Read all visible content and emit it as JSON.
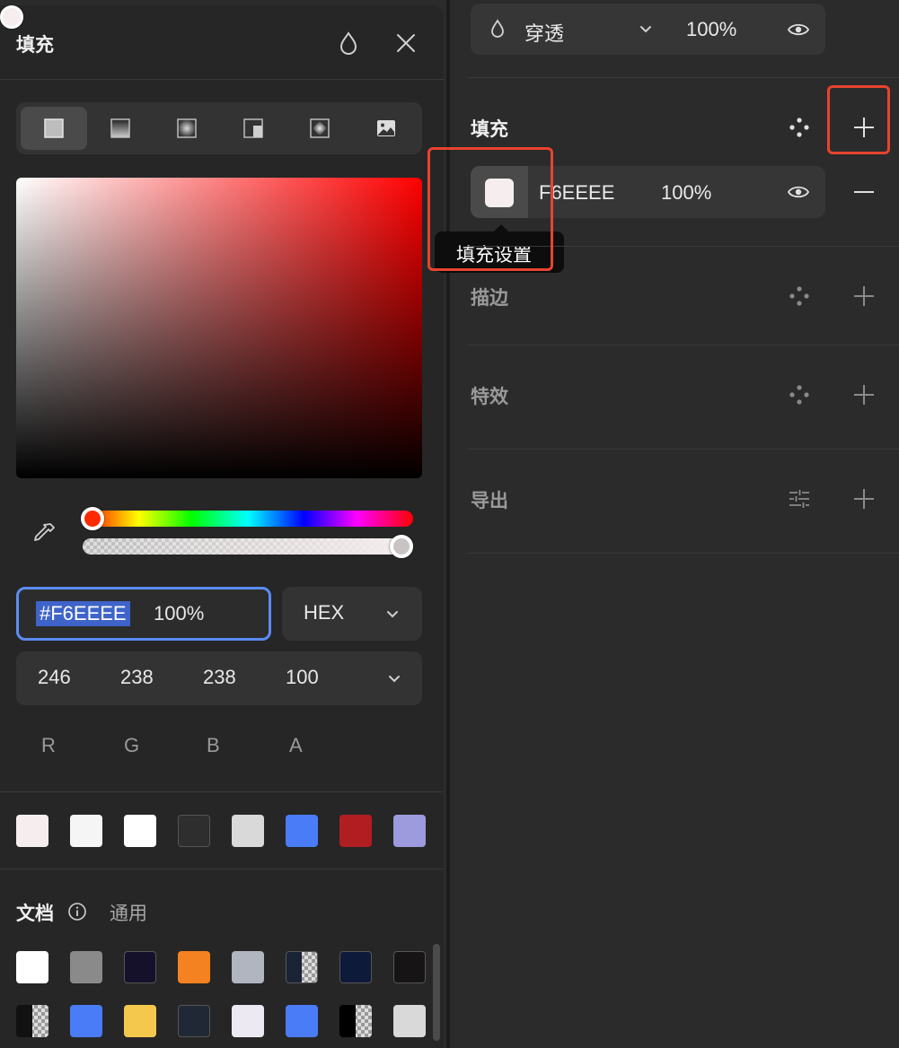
{
  "color_panel": {
    "title": "填充",
    "fill_types": [
      {
        "name": "solid",
        "selected": true
      },
      {
        "name": "linear-gradient"
      },
      {
        "name": "radial-gradient"
      },
      {
        "name": "angular-gradient"
      },
      {
        "name": "diamond-gradient"
      },
      {
        "name": "image"
      }
    ],
    "hue_fraction": 0.0,
    "alpha_fraction": 1.0,
    "hex_value": "#F6EEEE",
    "hex_alpha": "100%",
    "format": "HEX",
    "rgba_values": [
      "246",
      "238",
      "238",
      "100"
    ],
    "rgba_labels": [
      "R",
      "G",
      "B",
      "A"
    ],
    "recent_colors": [
      "#F6EEEE",
      "#F5F5F5",
      "#FFFFFF",
      "#2E2E2E",
      "#D9D9D9",
      "#4A7CF7",
      "#B01E22",
      "#9D9BDD"
    ],
    "tabs": {
      "document": "文档",
      "general": "通用"
    },
    "document_colors": [
      [
        "#FFFFFF",
        "#8A8A8A",
        "#16112B",
        "#F58220",
        "#B0B5C0",
        "#1A2436|half",
        "#0D1A3A",
        "#161414"
      ],
      [
        "#111111|half",
        "#4A7CF7",
        "#F4C84D",
        "#1F2834",
        "#ECE9F2",
        "#4A7CF7",
        "#000000|half",
        "#D9D9D9"
      ]
    ]
  },
  "properties": {
    "blend": {
      "mode": "穿透",
      "opacity": "100%"
    },
    "fill": {
      "title": "填充",
      "hex": "F6EEEE",
      "opacity": "100%",
      "swatch_color": "#F6EEEE"
    },
    "tooltip": "填充设置",
    "sections": [
      "描边",
      "特效",
      "导出"
    ]
  },
  "colors": {
    "accent_blue": "#5B8CF5",
    "highlight_red": "#E8432E"
  }
}
